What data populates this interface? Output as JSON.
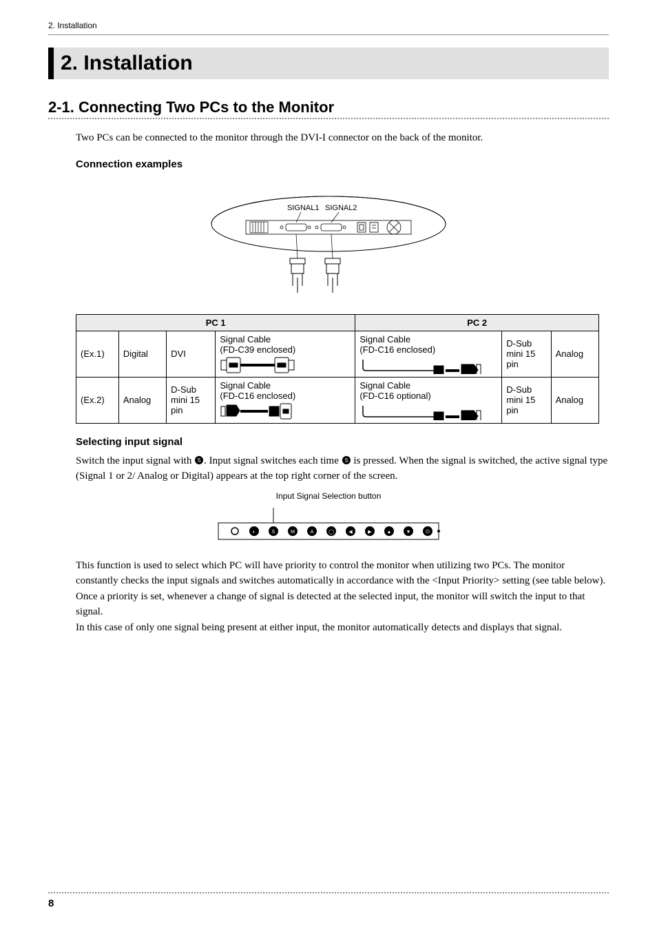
{
  "header": {
    "breadcrumb": "2. Installation"
  },
  "title": "2. Installation",
  "section": {
    "heading": "2-1. Connecting Two PCs to the Monitor",
    "intro": "Two PCs can be connected to the monitor through the DVI-I connector on the back of the monitor."
  },
  "subhead1": "Connection examples",
  "diagram": {
    "signal1": "SIGNAL1",
    "signal2": "SIGNAL2"
  },
  "table": {
    "pc1": "PC 1",
    "pc2": "PC 2",
    "rows": [
      {
        "ex": "(Ex.1)",
        "pc1_type": "Digital",
        "pc1_conn": "DVI",
        "pc1_cable_l1": "Signal Cable",
        "pc1_cable_l2": "(FD-C39 enclosed)",
        "pc2_cable_l1": "Signal Cable",
        "pc2_cable_l2": "(FD-C16 enclosed)",
        "pc2_conn_l1": "D-Sub",
        "pc2_conn_l2": "mini 15",
        "pc2_conn_l3": "pin",
        "pc2_type": "Analog"
      },
      {
        "ex": "(Ex.2)",
        "pc1_type": "Analog",
        "pc1_conn_l1": "D-Sub",
        "pc1_conn_l2": "mini 15",
        "pc1_conn_l3": "pin",
        "pc1_cable_l1": "Signal Cable",
        "pc1_cable_l2": "(FD-C16 enclosed)",
        "pc2_cable_l1": "Signal Cable",
        "pc2_cable_l2": "(FD-C16 optional)",
        "pc2_conn_l1": "D-Sub",
        "pc2_conn_l2": "mini 15",
        "pc2_conn_l3": "pin",
        "pc2_type": "Analog"
      }
    ]
  },
  "subhead2": "Selecting input signal",
  "para2a": "Switch the input signal with ",
  "para2b": ". Input signal switches each time ",
  "para2c": " is pressed. When the signal is switched, the active signal type (Signal 1 or 2/ Analog or Digital) appears at the top right corner of the screen.",
  "button_caption": "Input Signal Selection button",
  "para3": "This function is used to select which PC will have priority to control the monitor when utilizing two PCs. The monitor constantly checks the input signals and switches automatically in accordance with the <Input Priority> setting (see table below). Once a priority is set, whenever a change of signal is detected at the selected input, the monitor will switch the input to that signal.",
  "para4": "In this case of only one signal being present at either input, the monitor automatically detects and displays that signal.",
  "page_number": "8"
}
